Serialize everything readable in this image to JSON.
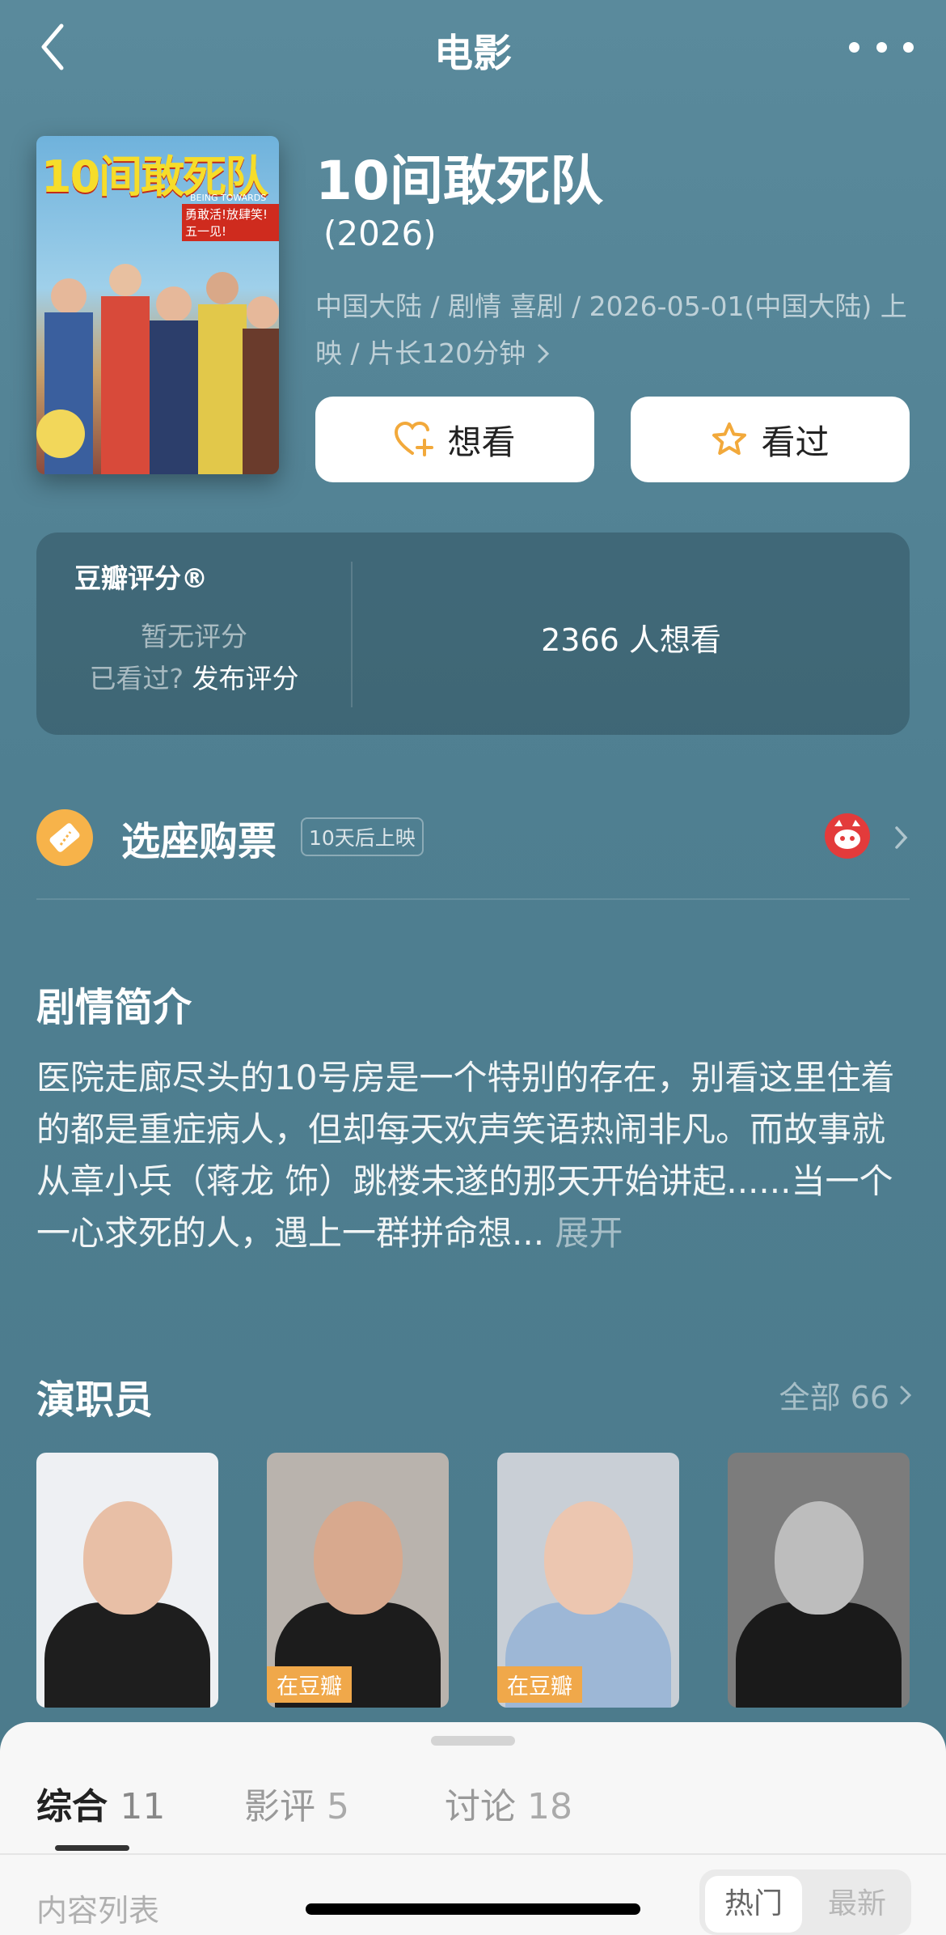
{
  "header": {
    "title": "电影",
    "back_icon": "chevron-left-icon",
    "more_icon": "more-dots-icon"
  },
  "movie": {
    "title": "10间敢死队",
    "year": "(2026)",
    "meta": "中国大陆 / 剧情 喜剧 / 2026-05-01(中国大陆) 上映 / 片长120分钟",
    "poster": {
      "title": "10间敢死队",
      "subtitle": "BEING TOWARDS DEATH",
      "tagline": "勇敢活!放肆笑!五一见!"
    }
  },
  "actions": {
    "want": "想看",
    "seen": "看过"
  },
  "rating": {
    "label": "豆瓣评分®",
    "none": "暂无评分",
    "seen_prompt": "已看过?",
    "publish": "发布评分",
    "want_count": "2366 人想看"
  },
  "ticket": {
    "label": "选座购票",
    "badge": "10天后上映"
  },
  "synopsis": {
    "title": "剧情简介",
    "text": "医院走廊尽头的10号房是一个特别的存在，别看这里住着的都是重症病人，但却每天欢声笑语热闹非凡。而故事就从章小兵（蒋龙 饰）跳楼未遂的那天开始讲起......当一个一心求死的人，遇上一群拼命想...",
    "expand": "展开"
  },
  "cast": {
    "title": "演职员",
    "all": "全部 66",
    "members": [
      {
        "badge": "",
        "bg": "#eef0f3",
        "body": "#1e1e1e",
        "face": "#e8bfa6"
      },
      {
        "badge": "在豆瓣",
        "bg": "#b9b3ad",
        "body": "#1c1c1c",
        "face": "#d8a98e"
      },
      {
        "badge": "在豆瓣",
        "bg": "#c9cfd6",
        "body": "#9db7d6",
        "face": "#ecc6b0"
      },
      {
        "badge": "",
        "bg": "#7c7c7c",
        "body": "#1a1a1a",
        "face": "#bdbdbd"
      }
    ]
  },
  "sheet": {
    "tabs": [
      {
        "label": "综合",
        "count": "11"
      },
      {
        "label": "影评",
        "count": "5"
      },
      {
        "label": "讨论",
        "count": "18"
      }
    ],
    "list_label": "内容列表",
    "sort_hot": "热门",
    "sort_new": "最新"
  },
  "colors": {
    "accent_orange": "#f7b34a",
    "background": "#548596",
    "badge_orange": "#f0a84a"
  }
}
